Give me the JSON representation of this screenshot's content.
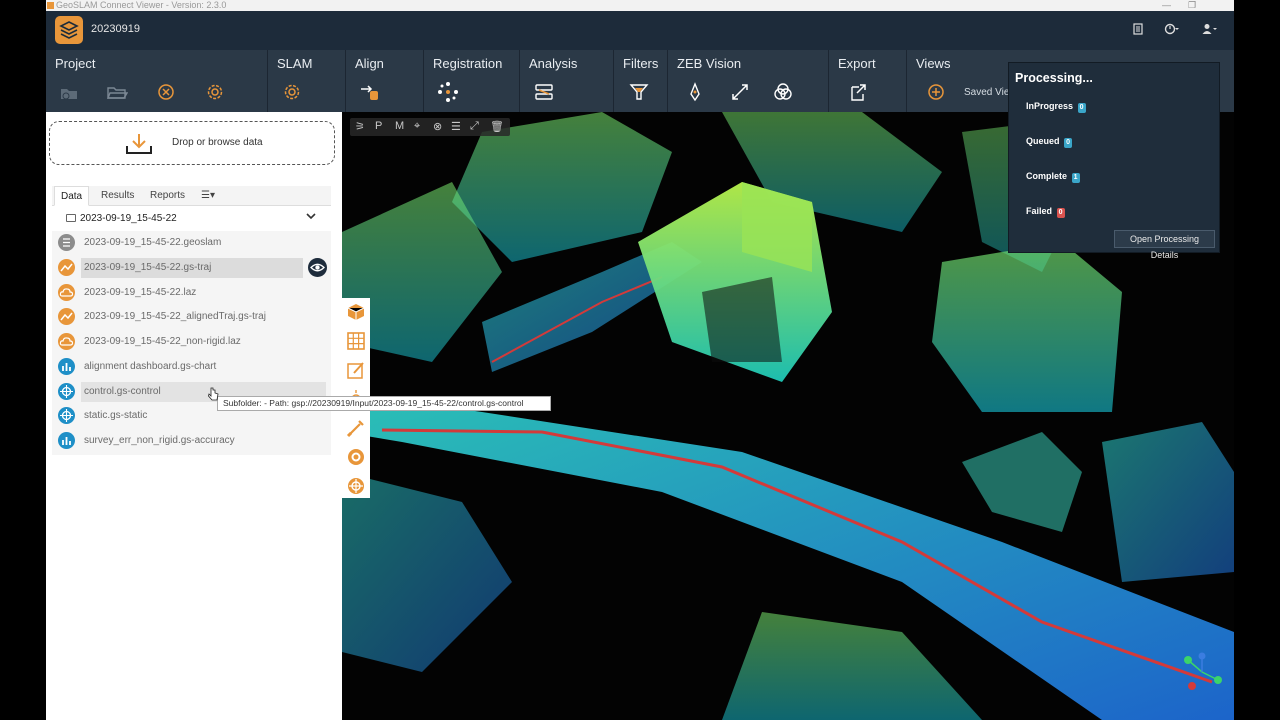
{
  "app": {
    "title": "GeoSLAM Connect Viewer - Version: 2.3.0",
    "project_name": "20230919"
  },
  "ribbon": {
    "groups": [
      {
        "label": "Project"
      },
      {
        "label": "SLAM"
      },
      {
        "label": "Align"
      },
      {
        "label": "Registration"
      },
      {
        "label": "Analysis"
      },
      {
        "label": "Filters"
      },
      {
        "label": "ZEB Vision"
      },
      {
        "label": "Export"
      },
      {
        "label": "Views"
      }
    ],
    "saved_views_label": "Saved Vie"
  },
  "sidepanel": {
    "drop_label": "Drop or browse data",
    "tabs": [
      {
        "label": "Data"
      },
      {
        "label": "Results"
      },
      {
        "label": "Reports"
      },
      {
        "label": "☰▾"
      }
    ],
    "folder_label": "2023-09-19_15-45-22",
    "files": [
      {
        "label": "2023-09-19_15-45-22.geoslam",
        "icon": "database-icon",
        "color": "#8c8c8c"
      },
      {
        "label": "2023-09-19_15-45-22.gs-traj",
        "icon": "trajectory-icon",
        "color": "#e8963a"
      },
      {
        "label": "2023-09-19_15-45-22.laz",
        "icon": "cloud-icon",
        "color": "#e8963a"
      },
      {
        "label": "2023-09-19_15-45-22_alignedTraj.gs-traj",
        "icon": "trajectory-icon",
        "color": "#e8963a"
      },
      {
        "label": "2023-09-19_15-45-22_non-rigid.laz",
        "icon": "cloud-icon",
        "color": "#e8963a"
      },
      {
        "label": "alignment dashboard.gs-chart",
        "icon": "chart-icon",
        "color": "#1e8fc7"
      },
      {
        "label": "control.gs-control",
        "icon": "crosshair-icon",
        "color": "#1e8fc7"
      },
      {
        "label": "static.gs-static",
        "icon": "crosshair-icon",
        "color": "#1e8fc7"
      },
      {
        "label": "survey_err_non_rigid.gs-accuracy",
        "icon": "chart-icon",
        "color": "#1e8fc7"
      }
    ],
    "tooltip": "Subfolder:  - Path: gsp://20230919/Input/2023-09-19_15-45-22/control.gs-control"
  },
  "viewer": {
    "toolbar_letters": [
      "P",
      "M"
    ]
  },
  "processing": {
    "title": "Processing...",
    "rows": [
      {
        "label": "InProgress",
        "count": "0",
        "color": "#3aa6c9"
      },
      {
        "label": "Queued",
        "count": "0",
        "color": "#3aa6c9"
      },
      {
        "label": "Complete",
        "count": "1",
        "color": "#3aa6c9"
      },
      {
        "label": "Failed",
        "count": "0",
        "color": "#d9534f"
      }
    ],
    "open_details_label": "Open Processing Details"
  },
  "colors": {
    "accent": "#e8963a",
    "header": "#1d2b3a",
    "ribbon": "#2b3947"
  }
}
